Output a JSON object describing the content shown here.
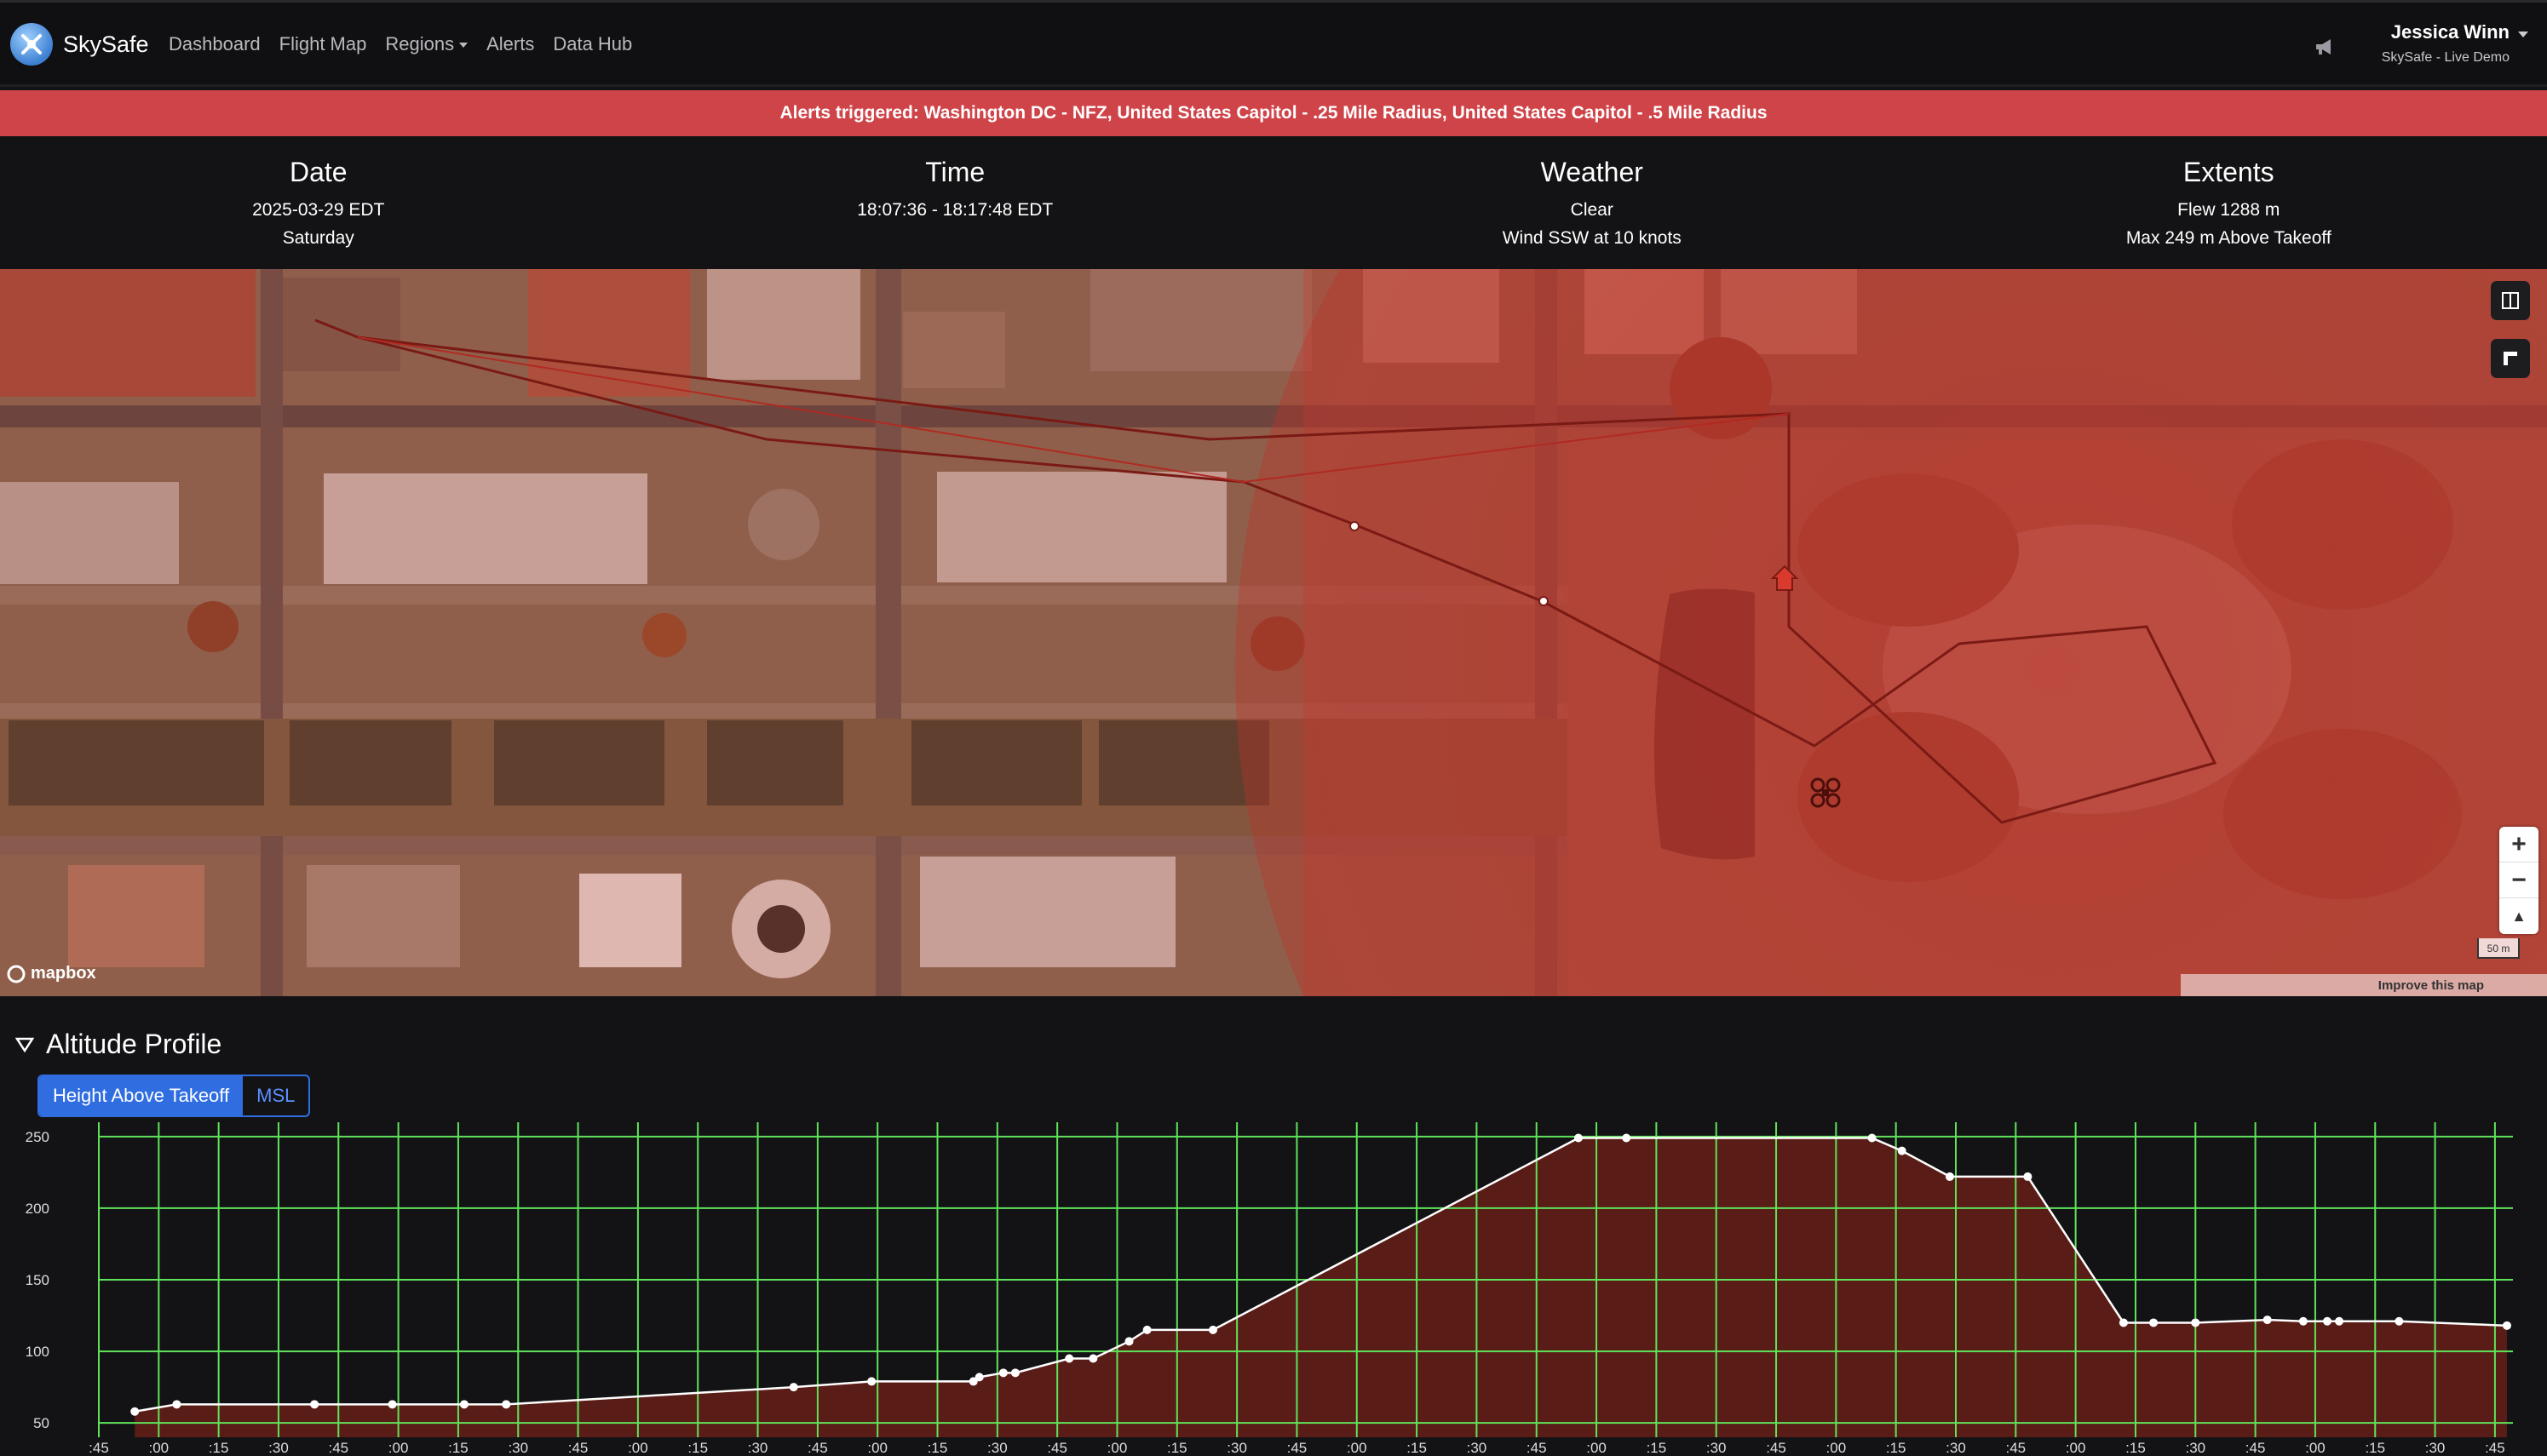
{
  "navbar": {
    "brand": "SkySafe",
    "links": [
      {
        "label": "Dashboard"
      },
      {
        "label": "Flight Map"
      },
      {
        "label": "Regions",
        "dropdown": true
      },
      {
        "label": "Alerts"
      },
      {
        "label": "Data Hub"
      }
    ],
    "user_name": "Jessica Winn",
    "user_subtitle": "SkySafe - Live Demo"
  },
  "alert": {
    "text": "Alerts triggered: Washington DC - NFZ, United States Capitol - .25 Mile Radius, United States Capitol - .5 Mile Radius",
    "color": "#cf4449"
  },
  "stats": {
    "date": {
      "title": "Date",
      "line1": "2025-03-29 EDT",
      "line2": "Saturday"
    },
    "time": {
      "title": "Time",
      "line1": "18:07:36 - 18:17:48 EDT"
    },
    "weather": {
      "title": "Weather",
      "line1": "Clear",
      "line2": "Wind SSW at 10 knots"
    },
    "extents": {
      "title": "Extents",
      "line1": "Flew 1288 m",
      "line2": "Max 249 m Above Takeoff"
    }
  },
  "map": {
    "logo": "mapbox",
    "scale_label": "50 m",
    "attribution": "Improve this map",
    "zoom_in": "+",
    "zoom_out": "−",
    "compass": "▲",
    "icons": [
      "split-view-icon",
      "draw-tool-icon",
      "zoom-in-icon",
      "zoom-out-icon",
      "compass-icon",
      "drone-icon",
      "home-icon"
    ]
  },
  "altitude": {
    "title": "Altitude Profile",
    "mode_active": "Height Above Takeoff",
    "mode_inactive": "MSL"
  },
  "chart_data": {
    "type": "area",
    "title": "",
    "xlabel": "",
    "ylabel": "",
    "yticks": [
      50,
      100,
      150,
      200,
      250
    ],
    "ylim": [
      40,
      260
    ],
    "x_tick_labels": [
      ":45",
      ":00",
      ":15",
      ":30",
      ":45",
      ":00",
      ":15",
      ":30",
      ":45",
      ":00",
      ":15",
      ":30",
      ":45",
      ":00",
      ":15",
      ":30",
      ":45",
      ":00",
      ":15",
      ":30",
      ":45",
      ":00",
      ":15",
      ":30",
      ":45",
      ":00",
      ":15",
      ":30",
      ":45",
      ":00",
      ":15",
      ":30",
      ":45",
      ":00",
      ":15",
      ":30",
      ":45",
      ":00",
      ":15",
      ":30",
      ":45"
    ],
    "xlim": [
      0,
      40.3
    ],
    "grid": true,
    "colors": {
      "line": "#ffffff",
      "fill": "#5a1c17",
      "grid": "#5fe35a"
    },
    "series": [
      {
        "points": [
          [
            0.6,
            58
          ],
          [
            1.3,
            63
          ],
          [
            3.6,
            63
          ],
          [
            4.9,
            63
          ],
          [
            6.1,
            63
          ],
          [
            6.8,
            63
          ],
          [
            11.6,
            75
          ],
          [
            12.9,
            79
          ],
          [
            14.6,
            79
          ],
          [
            14.7,
            82
          ],
          [
            15.1,
            85
          ],
          [
            15.3,
            85
          ],
          [
            16.2,
            95
          ],
          [
            16.6,
            95
          ],
          [
            17.2,
            107
          ],
          [
            17.5,
            115
          ],
          [
            18.6,
            115
          ],
          [
            24.7,
            249
          ],
          [
            25.5,
            249
          ],
          [
            29.6,
            249
          ],
          [
            30.1,
            240
          ],
          [
            30.9,
            222
          ],
          [
            32.2,
            222
          ],
          [
            33.8,
            120
          ],
          [
            34.3,
            120
          ],
          [
            35.0,
            120
          ],
          [
            36.2,
            122
          ],
          [
            36.8,
            121
          ],
          [
            37.2,
            121
          ],
          [
            37.4,
            121
          ],
          [
            38.4,
            121
          ],
          [
            40.2,
            118
          ]
        ]
      }
    ]
  }
}
